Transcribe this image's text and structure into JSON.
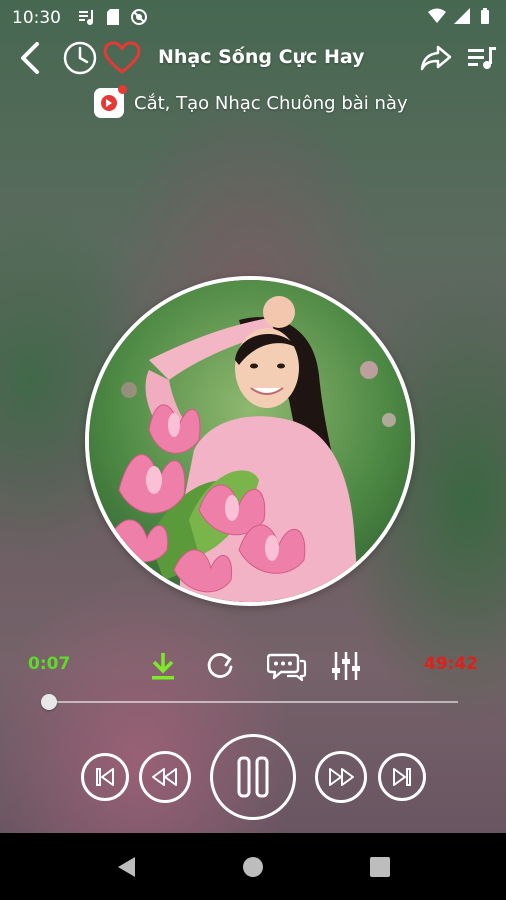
{
  "status_bar": {
    "time": "10:30",
    "left_icons": [
      "music-note-list-icon",
      "sd-card-icon",
      "no-disturb-icon"
    ],
    "right_icons": [
      "wifi-icon",
      "signal-icon",
      "battery-icon"
    ]
  },
  "header": {
    "title": "Nhạc Sống Cực Hay",
    "icons": [
      "back-icon",
      "timer-icon",
      "heart-icon",
      "share-icon",
      "playlist-icon"
    ]
  },
  "ringtone": {
    "label": "Cắt, Tạo Nhạc Chuông bài này",
    "icon": "ringtone-icon"
  },
  "player": {
    "elapsed": "0:07",
    "total": "49:42",
    "progress": 0.002,
    "controls": [
      "download-icon",
      "repeat-icon",
      "lyrics-icon",
      "equalizer-icon"
    ],
    "buttons": [
      "skip-previous-icon",
      "rewind-icon",
      "pause-icon",
      "fast-forward-icon",
      "skip-next-icon"
    ]
  },
  "colors": {
    "elapsed": "#5edb2a",
    "total": "#e0201a",
    "download": "#7ee82a",
    "favorite": "#e53935"
  },
  "nav_bar": {
    "icons": [
      "nav-back-icon",
      "nav-home-icon",
      "nav-recents-icon"
    ]
  }
}
